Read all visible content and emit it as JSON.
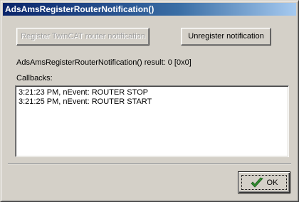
{
  "window": {
    "title": "AdsAmsRegisterRouterNotification()"
  },
  "buttons": {
    "register_label": "Register TwinCAT router notification",
    "unregister_label": "Unregister notification",
    "ok_label": "OK"
  },
  "result": {
    "text": "AdsAmsRegisterRouterNotification() result: 0 [0x0]"
  },
  "callbacks": {
    "label": "Callbacks:",
    "items": [
      "3:21:23 PM, nEvent: ROUTER STOP",
      "3:21:25 PM, nEvent: ROUTER START"
    ]
  },
  "icons": {
    "ok": "checkmark-icon"
  },
  "colors": {
    "checkmark": "#2e8b2e",
    "titlebar_start": "#0a246a",
    "titlebar_end": "#a6caf0"
  }
}
